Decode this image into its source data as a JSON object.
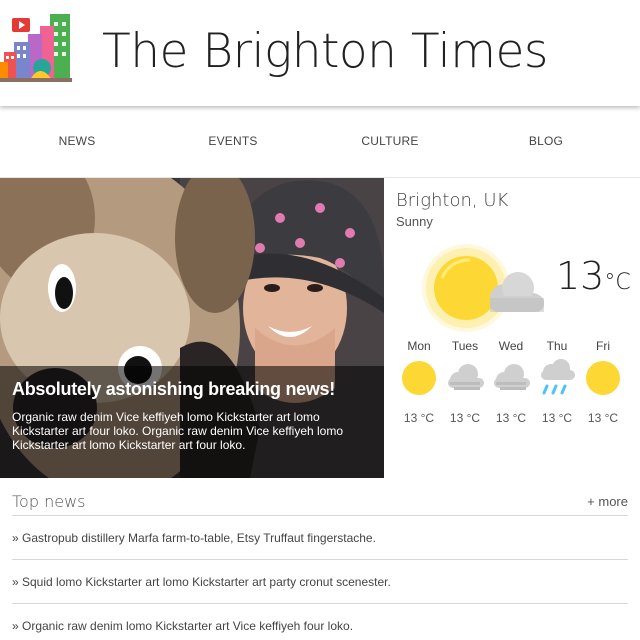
{
  "header": {
    "title": "The Brighton Times",
    "logo_icon": "city-buildings-logo-icon"
  },
  "nav": [
    {
      "label": "NEWS"
    },
    {
      "label": "EVENTS"
    },
    {
      "label": "CULTURE"
    },
    {
      "label": "BLOG"
    }
  ],
  "hero": {
    "headline": "Absolutely astonishing breaking news!",
    "text": "Organic raw denim Vice keffiyeh lomo Kickstarter art lomo Kickstarter art four loko. Organic raw denim Vice keffiyeh lomo Kickstarter art lomo Kickstarter art four loko."
  },
  "weather": {
    "city": "Brighton, UK",
    "condition": "Sunny",
    "temp": "13",
    "unit": "°C",
    "current_icon": "sun-cloud-icon",
    "forecast": [
      {
        "day": "Mon",
        "temp": "13 °C",
        "icon": "sun-icon"
      },
      {
        "day": "Tues",
        "temp": "13 °C",
        "icon": "cloud-icon"
      },
      {
        "day": "Wed",
        "temp": "13 °C",
        "icon": "cloud-icon"
      },
      {
        "day": "Thu",
        "temp": "13 °C",
        "icon": "rain-cloud-icon"
      },
      {
        "day": "Fri",
        "temp": "13 °C",
        "icon": "sun-icon"
      }
    ]
  },
  "top_news": {
    "title": "Top news",
    "more": "+ more",
    "items": [
      "» Gastropub distillery Marfa farm-to-table, Etsy Truffaut fingerstache.",
      "» Squid lomo Kickstarter art lomo Kickstarter art party cronut scenester.",
      "» Organic raw denim lomo Kickstarter art Vice keffiyeh four loko."
    ]
  },
  "colors": {
    "sun": "#fdd835",
    "cloud": "#cfcfcf",
    "rain": "#4fc3f7",
    "caption_bg": "rgba(0,0,0,0.55)"
  }
}
